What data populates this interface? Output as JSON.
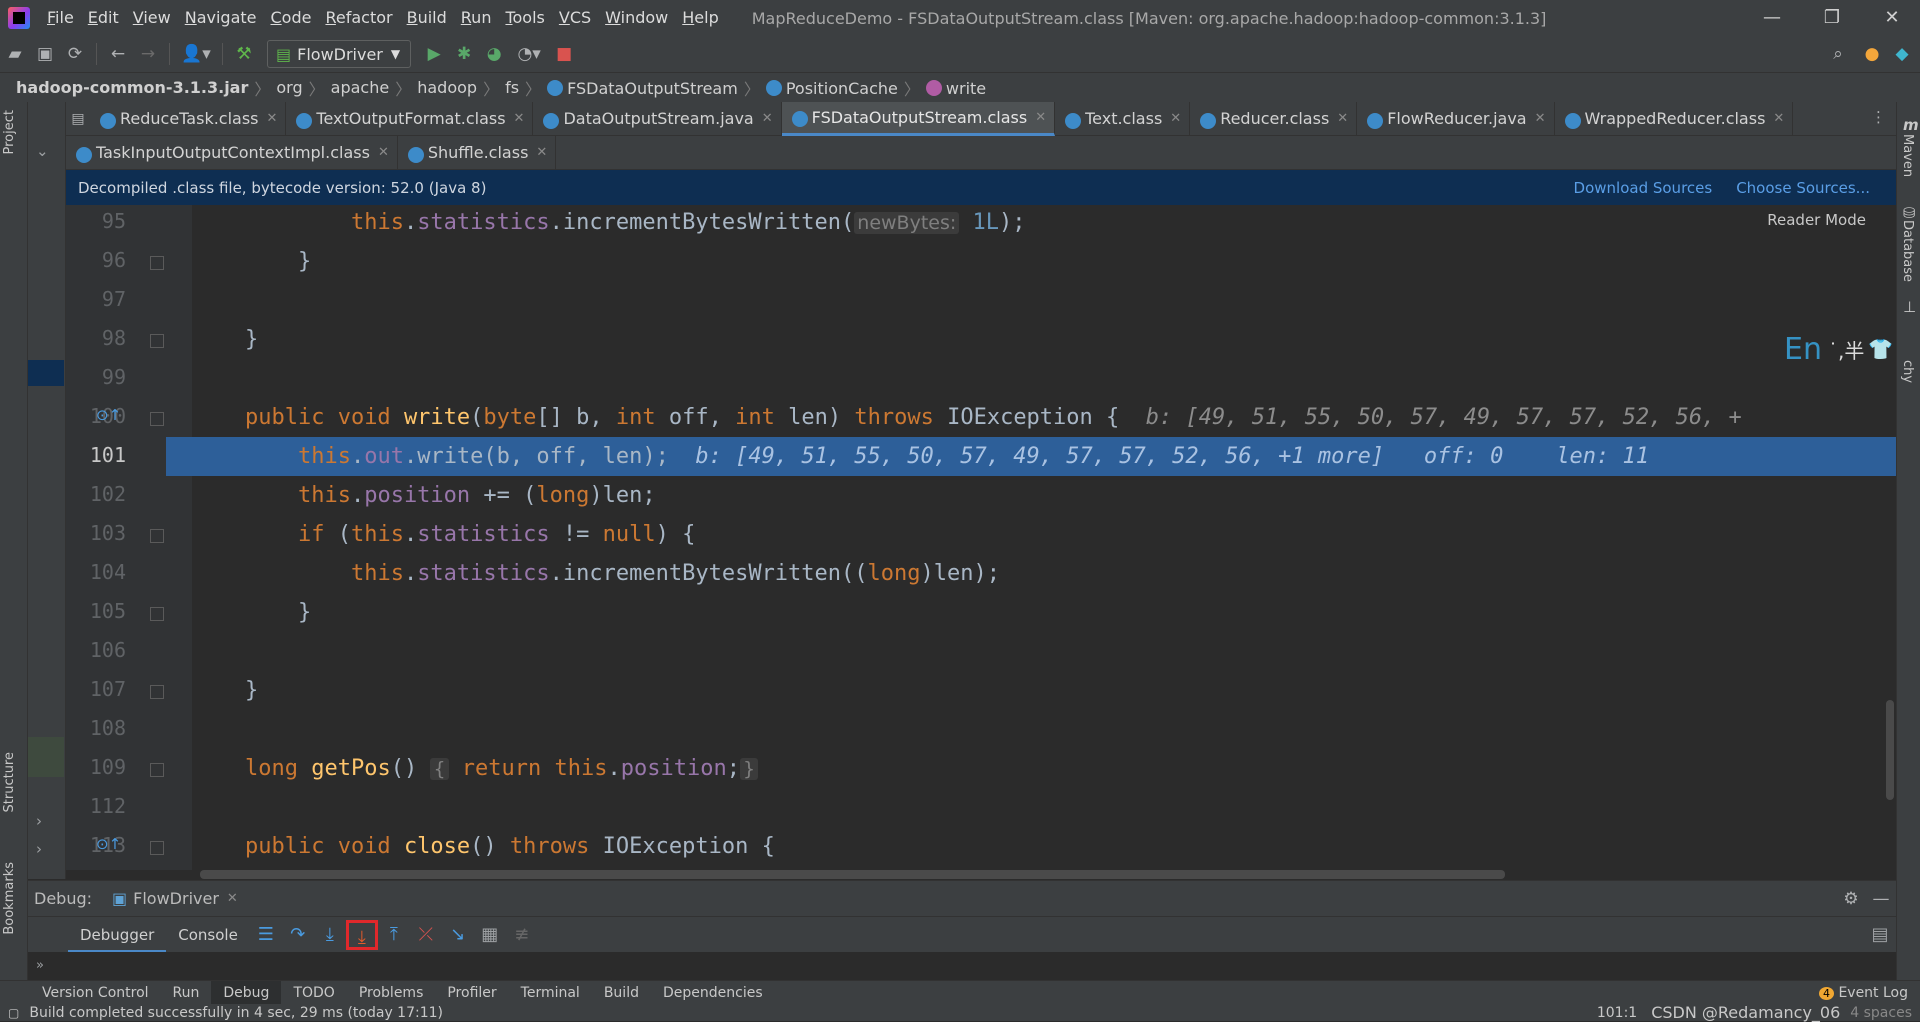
{
  "menu": {
    "items": [
      "File",
      "Edit",
      "View",
      "Navigate",
      "Code",
      "Refactor",
      "Build",
      "Run",
      "Tools",
      "VCS",
      "Window",
      "Help"
    ],
    "window_title": "MapReduceDemo - FSDataOutputStream.class [Maven: org.apache.hadoop:hadoop-common:3.1.3]"
  },
  "toolbar": {
    "run_config": "FlowDriver"
  },
  "breadcrumb": {
    "items": [
      "hadoop-common-3.1.3.jar",
      "org",
      "apache",
      "hadoop",
      "fs",
      "FSDataOutputStream",
      "PositionCache",
      "write"
    ]
  },
  "tabs_row1": [
    {
      "label": "ReduceTask.class",
      "active": false
    },
    {
      "label": "TextOutputFormat.class",
      "active": false
    },
    {
      "label": "DataOutputStream.java",
      "active": false
    },
    {
      "label": "FSDataOutputStream.class",
      "active": true
    },
    {
      "label": "Text.class",
      "active": false
    },
    {
      "label": "Reducer.class",
      "active": false
    },
    {
      "label": "FlowReducer.java",
      "active": false
    },
    {
      "label": "WrappedReducer.class",
      "active": false
    }
  ],
  "tabs_row2": [
    {
      "label": "TaskInputOutputContextImpl.class",
      "active": false
    },
    {
      "label": "Shuffle.class",
      "active": false
    }
  ],
  "banner": {
    "text": "Decompiled .class file, bytecode version: 52.0 (Java 8)",
    "download": "Download Sources",
    "choose": "Choose Sources..."
  },
  "editor": {
    "reader_mode": "Reader Mode",
    "line_numbers": [
      "95",
      "96",
      "97",
      "98",
      "99",
      "100",
      "101",
      "102",
      "103",
      "104",
      "105",
      "106",
      "107",
      "108",
      "109",
      "112",
      "113"
    ],
    "current_line": "101",
    "lines": [
      {
        "segments": [
          [
            "",
            "            "
          ],
          [
            "kw",
            "this"
          ],
          [
            "",
            ""
          ],
          [
            "",
            "."
          ],
          [
            "fld",
            "statistics"
          ],
          [
            "",
            ".incrementBytesWritten("
          ],
          [
            "hint",
            "newBytes:"
          ],
          [
            "",
            " "
          ],
          [
            "num",
            "1L"
          ],
          [
            "",
            ");"
          ]
        ]
      },
      {
        "segments": [
          [
            "",
            "        }"
          ]
        ]
      },
      {
        "segments": [
          [
            "",
            ""
          ]
        ]
      },
      {
        "segments": [
          [
            "",
            "    }"
          ]
        ]
      },
      {
        "segments": [
          [
            "",
            ""
          ]
        ]
      },
      {
        "segments": [
          [
            "",
            "    "
          ],
          [
            "kw",
            "public void "
          ],
          [
            "fn",
            "write"
          ],
          [
            "",
            "("
          ],
          [
            "kw",
            "byte"
          ],
          [
            "",
            "[] b, "
          ],
          [
            "kw",
            "int"
          ],
          [
            "",
            " off, "
          ],
          [
            "kw",
            "int"
          ],
          [
            "",
            " len) "
          ],
          [
            "kw",
            "throws"
          ],
          [
            "",
            " IOException {  "
          ],
          [
            "inl",
            "b: [49, 51, 55, 50, 57, 49, 57, 57, 52, 56, +"
          ]
        ]
      },
      {
        "hl": true,
        "segments": [
          [
            "",
            "        "
          ],
          [
            "kw",
            "this"
          ],
          [
            "",
            "."
          ],
          [
            "fld",
            "out"
          ],
          [
            "",
            ".write(b, off, len);  "
          ],
          [
            "inl",
            "b: [49, 51, 55, 50, 57, 49, 57, 57, 52, 56, +1 more]   off: 0    len: 11"
          ]
        ]
      },
      {
        "segments": [
          [
            "",
            "        "
          ],
          [
            "kw",
            "this"
          ],
          [
            "",
            "."
          ],
          [
            "fld",
            "position"
          ],
          [
            "",
            " += ("
          ],
          [
            "kw",
            "long"
          ],
          [
            "",
            ")len;"
          ]
        ]
      },
      {
        "segments": [
          [
            "",
            "        "
          ],
          [
            "kw",
            "if"
          ],
          [
            "",
            " ("
          ],
          [
            "kw",
            "this"
          ],
          [
            "",
            "."
          ],
          [
            "fld",
            "statistics"
          ],
          [
            "",
            " != "
          ],
          [
            "kw",
            "null"
          ],
          [
            "",
            ") {"
          ]
        ]
      },
      {
        "segments": [
          [
            "",
            "            "
          ],
          [
            "kw",
            "this"
          ],
          [
            "",
            "."
          ],
          [
            "fld",
            "statistics"
          ],
          [
            "",
            ".incrementBytesWritten(("
          ],
          [
            "kw",
            "long"
          ],
          [
            "",
            ")len);"
          ]
        ]
      },
      {
        "segments": [
          [
            "",
            "        }"
          ]
        ]
      },
      {
        "segments": [
          [
            "",
            ""
          ]
        ]
      },
      {
        "segments": [
          [
            "",
            "    }"
          ]
        ]
      },
      {
        "segments": [
          [
            "",
            ""
          ]
        ]
      },
      {
        "segments": [
          [
            "",
            "    "
          ],
          [
            "kw",
            "long "
          ],
          [
            "fn",
            "getPos"
          ],
          [
            "",
            "() "
          ],
          [
            "hint",
            "{"
          ],
          [
            "",
            " "
          ],
          [
            "kw",
            "return this"
          ],
          [
            "",
            "."
          ],
          [
            "fld",
            "position"
          ],
          [
            "",
            ";"
          ],
          [
            "hint",
            "}"
          ]
        ]
      },
      {
        "segments": [
          [
            "",
            ""
          ]
        ]
      },
      {
        "segments": [
          [
            "",
            "    "
          ],
          [
            "kw",
            "public void "
          ],
          [
            "fn",
            "close"
          ],
          [
            "",
            "() "
          ],
          [
            "kw",
            "throws"
          ],
          [
            "",
            " IOException {"
          ]
        ]
      }
    ]
  },
  "ime": {
    "lang": "En",
    "extra": "˙,半"
  },
  "debug": {
    "label": "Debug:",
    "session": "FlowDriver",
    "tabs": [
      "Debugger",
      "Console"
    ]
  },
  "side_labels": {
    "project": "Project",
    "structure": "Structure",
    "bookmarks": "Bookmarks",
    "maven": "Maven",
    "database": "Database",
    "hierarchy": "chy"
  },
  "toolwindows": [
    "Version Control",
    "Run",
    "Debug",
    "TODO",
    "Problems",
    "Profiler",
    "Terminal",
    "Build",
    "Dependencies"
  ],
  "event_log": {
    "count": "4",
    "label": "Event Log"
  },
  "status": {
    "message": "Build completed successfully in 4 sec, 29 ms (today 17:11)",
    "position": "101:1",
    "watermark": "CSDN @Redamancy_06",
    "indent": "4 spaces"
  },
  "colors": {
    "accent": "#4a88c7",
    "highlight_line": "#2d5f99",
    "banner_bg": "#0e2e52",
    "red_box": "#e0282b"
  }
}
